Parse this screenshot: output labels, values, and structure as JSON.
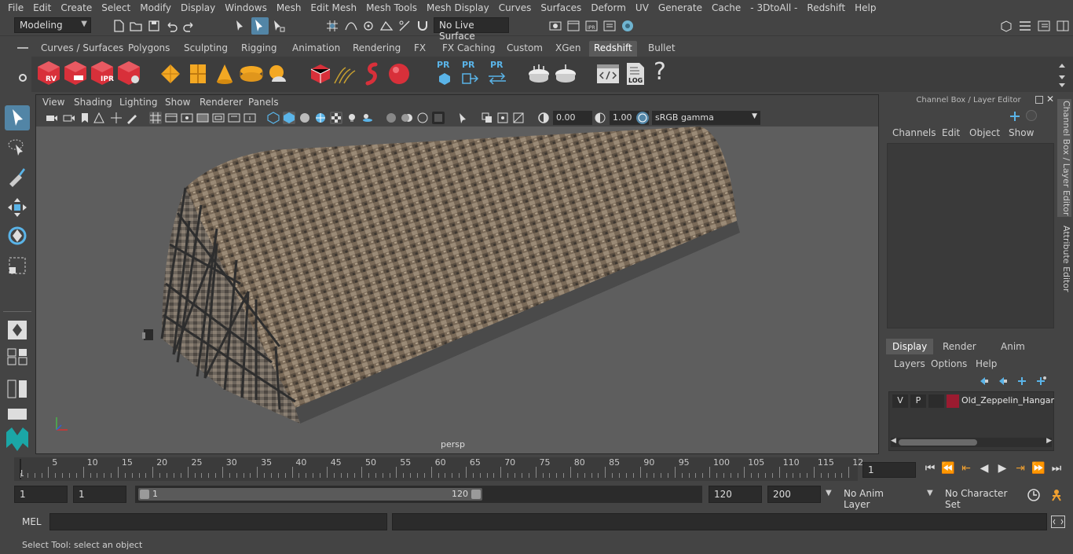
{
  "menu": [
    "File",
    "Edit",
    "Create",
    "Select",
    "Modify",
    "Display",
    "Windows",
    "Mesh",
    "Edit Mesh",
    "Mesh Tools",
    "Mesh Display",
    "Curves",
    "Surfaces",
    "Deform",
    "UV",
    "Generate",
    "Cache",
    "- 3DtoAll -",
    "Redshift",
    "Help"
  ],
  "status": {
    "mode": "Modeling",
    "live_surface": "No Live Surface"
  },
  "shelf_tabs": [
    "Curves / Surfaces",
    "Polygons",
    "Sculpting",
    "Rigging",
    "Animation",
    "Rendering",
    "FX",
    "FX Caching",
    "Custom",
    "XGen",
    "Redshift",
    "Bullet"
  ],
  "shelf_active": "Redshift",
  "shelf_labels": {
    "rv": "RV",
    "ipr": "IPR",
    "pr1": "PR",
    "pr2": "PR",
    "pr3": "PR",
    "log": "LOG",
    "help": "?"
  },
  "viewport": {
    "menu": [
      "View",
      "Shading",
      "Lighting",
      "Show",
      "Renderer",
      "Panels"
    ],
    "exposure": "0.00",
    "gamma": "1.00",
    "colorspace": "sRGB gamma",
    "camera": "persp"
  },
  "channel_box": {
    "title": "Channel Box / Layer Editor",
    "menu": [
      "Channels",
      "Edit",
      "Object",
      "Show"
    ],
    "layer_tabs": [
      "Display",
      "Render",
      "Anim"
    ],
    "layer_tab_active": "Display",
    "layer_menu": [
      "Layers",
      "Options",
      "Help"
    ],
    "layer": {
      "v": "V",
      "p": "P",
      "name": "Old_Zeppelin_Hangar",
      "color": "#9b1b30"
    }
  },
  "side_tabs": [
    "Channel Box / Layer Editor",
    "Attribute Editor"
  ],
  "timeline": {
    "ticks": [
      "5",
      "10",
      "15",
      "20",
      "25",
      "30",
      "35",
      "40",
      "45",
      "50",
      "55",
      "60",
      "65",
      "70",
      "75",
      "80",
      "85",
      "90",
      "95",
      "100",
      "105",
      "110",
      "115",
      "12"
    ],
    "start_label": "1",
    "current_frame": "1"
  },
  "range": {
    "start": "1",
    "playback_start": "1",
    "slider_start": "1",
    "slider_end": "120",
    "playback_end": "120",
    "end": "200",
    "anim_layer": "No Anim Layer",
    "character_set": "No Character Set"
  },
  "command": {
    "lang": "MEL"
  },
  "help_line": "Select Tool: select an object",
  "colors": {
    "accent": "#5285a6",
    "redshift_red": "#d8303a",
    "bg": "#444444",
    "viewport": "#5e5e5e"
  }
}
